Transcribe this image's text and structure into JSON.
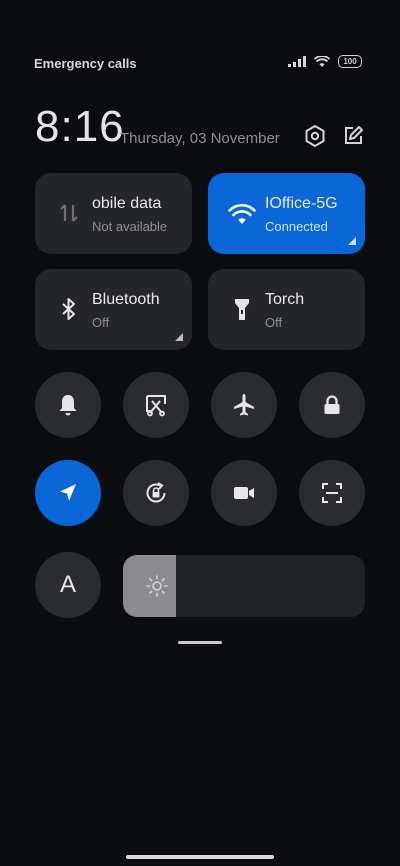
{
  "status_bar": {
    "carrier_text": "Emergency calls o",
    "battery_level": "100",
    "icons": [
      "signal-icon",
      "wifi-icon",
      "battery-icon"
    ]
  },
  "header": {
    "time": "8:16",
    "date": "Thursday, 03 November",
    "icons": [
      "settings-icon",
      "edit-icon"
    ]
  },
  "tiles": {
    "mobile_data": {
      "label": "obile data",
      "status": "Not available",
      "icon": "mobile-data-icon",
      "active": false
    },
    "wifi": {
      "label": "IOffice-5G",
      "status": "Connected",
      "icon": "wifi-icon",
      "active": true
    },
    "bluetooth": {
      "label": "Bluetooth",
      "status": "Off",
      "icon": "bluetooth-icon",
      "active": false
    },
    "torch": {
      "label": "Torch",
      "status": "Off",
      "icon": "torch-icon",
      "active": false
    }
  },
  "toggles": [
    {
      "name": "silent-mode",
      "icon": "bell-icon",
      "active": false
    },
    {
      "name": "screenshot",
      "icon": "screenshot-icon",
      "active": false
    },
    {
      "name": "airplane-mode",
      "icon": "airplane-icon",
      "active": false
    },
    {
      "name": "lock-screen",
      "icon": "lock-icon",
      "active": false
    },
    {
      "name": "location",
      "icon": "location-icon",
      "active": true
    },
    {
      "name": "auto-rotate",
      "icon": "rotate-lock-icon",
      "active": false
    },
    {
      "name": "screen-recorder",
      "icon": "video-camera-icon",
      "active": false
    },
    {
      "name": "scanner",
      "icon": "scan-icon",
      "active": false
    }
  ],
  "auto_brightness": {
    "label": "A"
  },
  "brightness": {
    "level_percent": 22,
    "icon": "sun-icon"
  },
  "colors": {
    "accent": "#0a67d8",
    "tile_bg": "#25262a",
    "background": "#0c0d10"
  }
}
